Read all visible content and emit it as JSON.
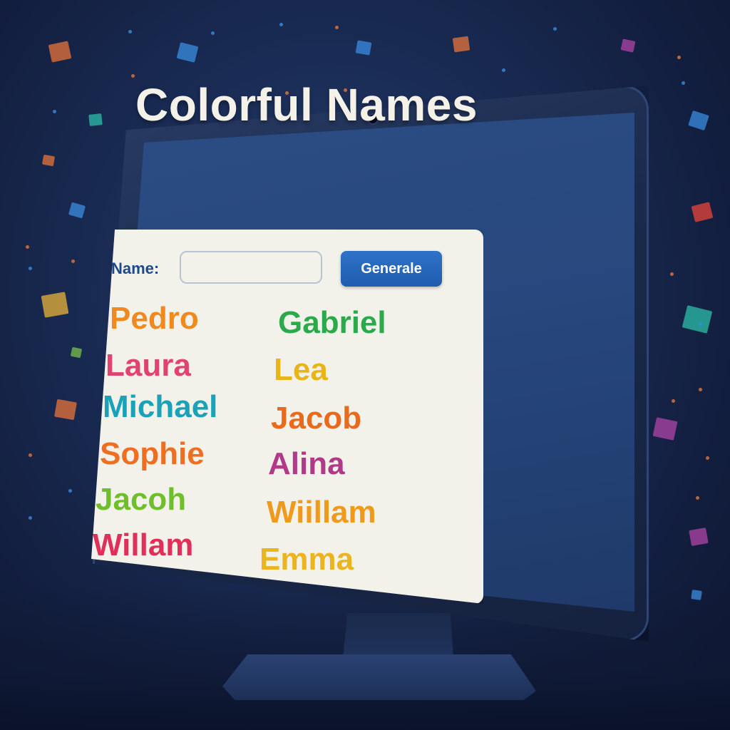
{
  "app": {
    "title": "Colorful Names"
  },
  "form": {
    "name_label": "Name:",
    "name_input_value": "",
    "generate_label": "Generale"
  },
  "names_left": [
    {
      "text": "Pedro",
      "color": "#f08a1e"
    },
    {
      "text": "Laura",
      "color": "#e0436f"
    },
    {
      "text": "Michael",
      "color": "#1aa3b8"
    },
    {
      "text": "Sophie",
      "color": "#ef6f22"
    },
    {
      "text": "Jacoh",
      "color": "#6fbf2a"
    },
    {
      "text": "Willam",
      "color": "#e0305a"
    }
  ],
  "names_right": [
    {
      "text": "Gabriel",
      "color": "#2aaa4a"
    },
    {
      "text": "Lea",
      "color": "#e9b416"
    },
    {
      "text": "Jacob",
      "color": "#e96a1c"
    },
    {
      "text": "Alina",
      "color": "#b03a88"
    },
    {
      "text": "Wiillam",
      "color": "#ef9a1a"
    },
    {
      "text": "Emma",
      "color": "#eab51e"
    }
  ],
  "colors": {
    "accent": "#2f73c9",
    "label": "#1f4a8a",
    "background": "#1a2c55"
  }
}
